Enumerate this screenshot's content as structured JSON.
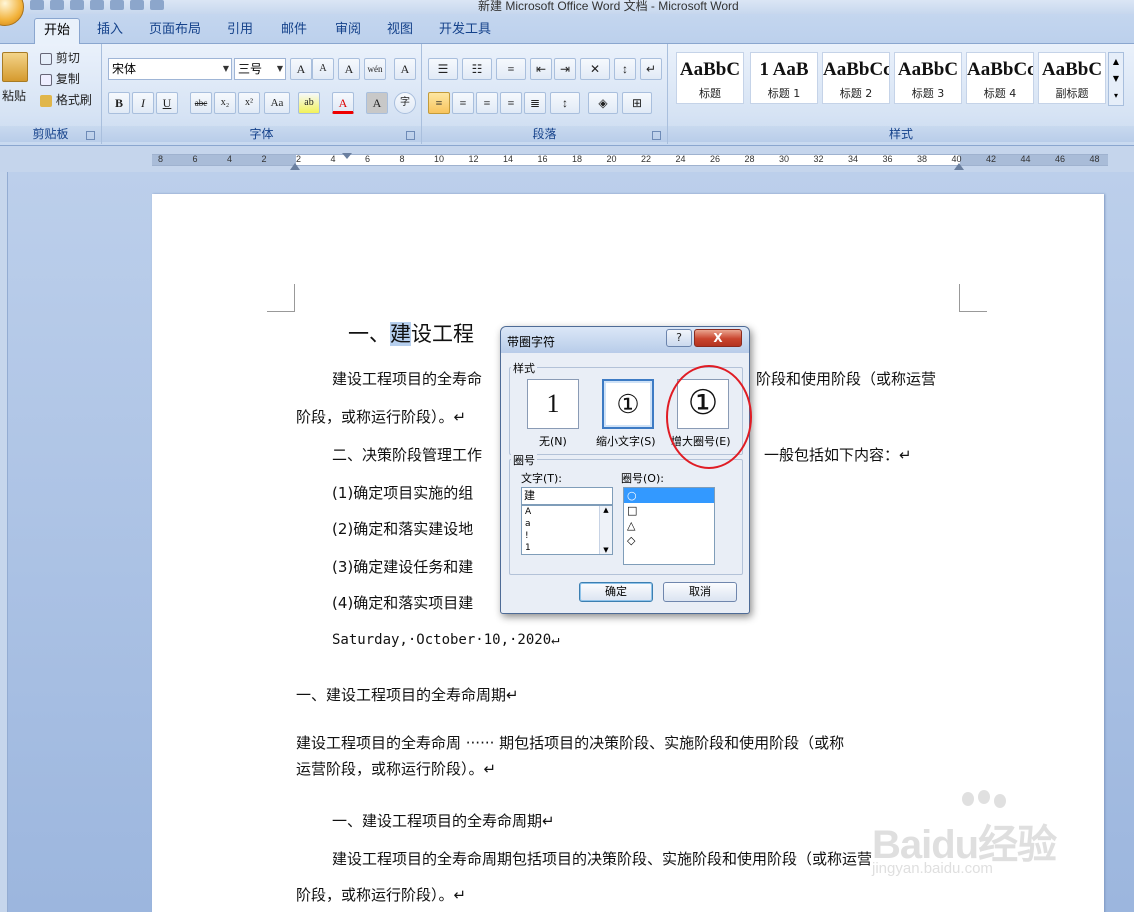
{
  "window": {
    "title": "新建 Microsoft Office Word 文档 - Microsoft Word"
  },
  "tabs": [
    "开始",
    "插入",
    "页面布局",
    "引用",
    "邮件",
    "审阅",
    "视图",
    "开发工具"
  ],
  "ribbon": {
    "clipboard": {
      "label": "剪贴板",
      "paste": "粘贴",
      "cut": "剪切",
      "copy": "复制",
      "format_painter": "格式刷"
    },
    "font": {
      "label": "字体",
      "font_name": "宋体",
      "font_size": "三号",
      "grow": "A",
      "shrink": "A",
      "clear": "A",
      "phonetic": "wén",
      "border_char": "A",
      "bold": "B",
      "italic": "I",
      "underline": "U",
      "strike": "abc",
      "subscript": "x₂",
      "superscript": "x²",
      "change_case": "Aa",
      "highlight": "ab",
      "font_color": "A",
      "shading": "A",
      "enclose": "字"
    },
    "paragraph": {
      "label": "段落"
    },
    "styles": {
      "label": "样式",
      "items": [
        {
          "sample": "AaBbC",
          "name": "标题"
        },
        {
          "sample": "1 AaB",
          "name": "标题 1"
        },
        {
          "sample": "AaBbCc",
          "name": "标题 2"
        },
        {
          "sample": "AaBbC",
          "name": "标题 3"
        },
        {
          "sample": "AaBbCc",
          "name": "标题 4"
        },
        {
          "sample": "AaBbC",
          "name": "副标题"
        }
      ]
    }
  },
  "ruler": {
    "numbers": [
      "8",
      "6",
      "4",
      "2",
      "2",
      "4",
      "6",
      "8",
      "10",
      "12",
      "14",
      "16",
      "18",
      "20",
      "22",
      "24",
      "26",
      "28",
      "30",
      "32",
      "34",
      "36",
      "38",
      "40",
      "42",
      "44",
      "46",
      "48"
    ]
  },
  "document": {
    "title_prefix": "一、",
    "title_selected": "建",
    "title_rest": "设工程",
    "lines": [
      "建设工程项目的全寿命",
      "阶段和使用阶段（或称运营",
      "阶段，或称运行阶段）。↵",
      "二、决策阶段管理工作",
      "一般包括如下内容：↵",
      "(1)确定项目实施的组",
      "(2)确定和落实建设地",
      "(3)确定建设任务和建",
      "(4)确定和落实项目建",
      "Saturday,·October·10,·2020↵",
      "一、建设工程项目的全寿命周期↵",
      "建设工程项目的全寿命周 ······ 期包括项目的决策阶段、实施阶段和使用阶段（或称",
      "运营阶段，或称运行阶段）。↵",
      "一、建设工程项目的全寿命周期↵",
      "建设工程项目的全寿命周期包括项目的决策阶段、实施阶段和使用阶段（或称运营",
      "阶段，或称运行阶段）。↵"
    ]
  },
  "dialog": {
    "title": "带圈字符",
    "help": "?",
    "close": "X",
    "style_section": "样式",
    "options": [
      {
        "glyph": "1",
        "label": "无(N)"
      },
      {
        "glyph": "①",
        "label": "缩小文字(S)"
      },
      {
        "glyph": "①",
        "label": "增大圈号(E)"
      }
    ],
    "enclosure_section": "圈号",
    "text_label": "文字(T):",
    "text_value": "建",
    "text_list": [
      "A",
      "a",
      "!",
      "1"
    ],
    "circle_label": "圈号(O):",
    "circle_list": [
      "○",
      "□",
      "△",
      "◇"
    ],
    "ok": "确定",
    "cancel": "取消"
  },
  "watermark": {
    "brand": "Baidu经验",
    "url": "jingyan.baidu.com"
  },
  "colors": {
    "highlight_circle": "#e01c24",
    "selection": "#b6cfee",
    "ribbon_blue": "#15428b"
  }
}
